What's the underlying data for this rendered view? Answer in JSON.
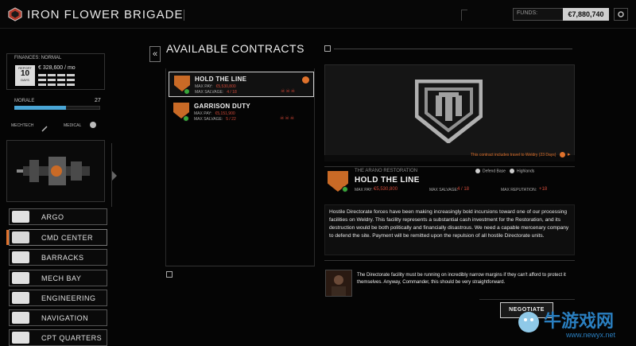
{
  "app": {
    "title": "IRON FLOWER BRIGADE"
  },
  "funds": {
    "label": "FUNDS:",
    "value": "€7,880,740"
  },
  "finances": {
    "label": "FINANCES: NORMAL",
    "report_top": "REPORT",
    "report_days": "10",
    "report_bottom": "DAYS",
    "burn_rate": "€ 328,600 / mo"
  },
  "morale": {
    "label": "MORALE",
    "value": "27",
    "level": 0.6
  },
  "mechtech": {
    "label": "MECHTECH"
  },
  "medical": {
    "label": "MEDICAL"
  },
  "nav": {
    "items": [
      {
        "label": "ARGO",
        "icon": "argo-icon"
      },
      {
        "label": "CMD CENTER",
        "icon": "cmd-center-icon"
      },
      {
        "label": "BARRACKS",
        "icon": "barracks-icon"
      },
      {
        "label": "MECH BAY",
        "icon": "mech-bay-icon"
      },
      {
        "label": "ENGINEERING",
        "icon": "engineering-icon"
      },
      {
        "label": "NAVIGATION",
        "icon": "navigation-icon"
      },
      {
        "label": "CPT QUARTERS",
        "icon": "cpt-quarters-icon"
      }
    ],
    "active": "CMD CENTER"
  },
  "contracts_panel": {
    "heading": "AVAILABLE CONTRACTS",
    "collapse": "«",
    "contracts": [
      {
        "name": "HOLD THE LINE",
        "pay_label": "MAX PAY:",
        "pay_value": "€5,530,800",
        "salvage_label": "MAX SALVAGE:",
        "salvage_value": "4 / 18",
        "difficulty_skulls": "☠☠☠",
        "selected": true
      },
      {
        "name": "GARRISON DUTY",
        "pay_label": "MAX PAY:",
        "pay_value": "€5,151,900",
        "salvage_label": "MAX SALVAGE:",
        "salvage_value": "5 / 22",
        "difficulty_skulls": "☠☠☠",
        "selected": false
      }
    ]
  },
  "detail": {
    "travel_note": "This contract includes travel to Weldry (23 Days)",
    "employer": "THE ARANO RESTORATION",
    "title": "HOLD THE LINE",
    "tags": [
      "Defend Base",
      "Highlands"
    ],
    "max_pay_label": "MAX PAY:",
    "max_pay_value": "€5,530,800",
    "max_salvage_label": "MAX SALVAGE:",
    "max_salvage_value": "4 / 18",
    "max_reputation_label": "MAX REPUTATION:",
    "max_reputation_value": "+18",
    "description": "Hostile Directorate forces have been making increasingly bold incursions toward one of our processing facilities on Weldry. This facility represents a substantial cash investment for the Restoration, and its destruction would be both politically and financially disastrous. We need a capable mercenary company to defend the site. Payment will be remitted upon the repulsion of all hostile Directorate units.",
    "commander_quote": "The Directorate facility must be running on incredibly narrow margins if they can't afford to protect it themselves. Anyway, Commander, this should be very straightforward.",
    "negotiate": "NEGOTIATE"
  },
  "watermark": {
    "text_cn": "牛游戏网",
    "url": "www.newyx.net"
  },
  "colors": {
    "accent": "#e0722c",
    "danger": "#d14a3a",
    "ok": "#38a63a",
    "morale": "#4aa6d6"
  }
}
